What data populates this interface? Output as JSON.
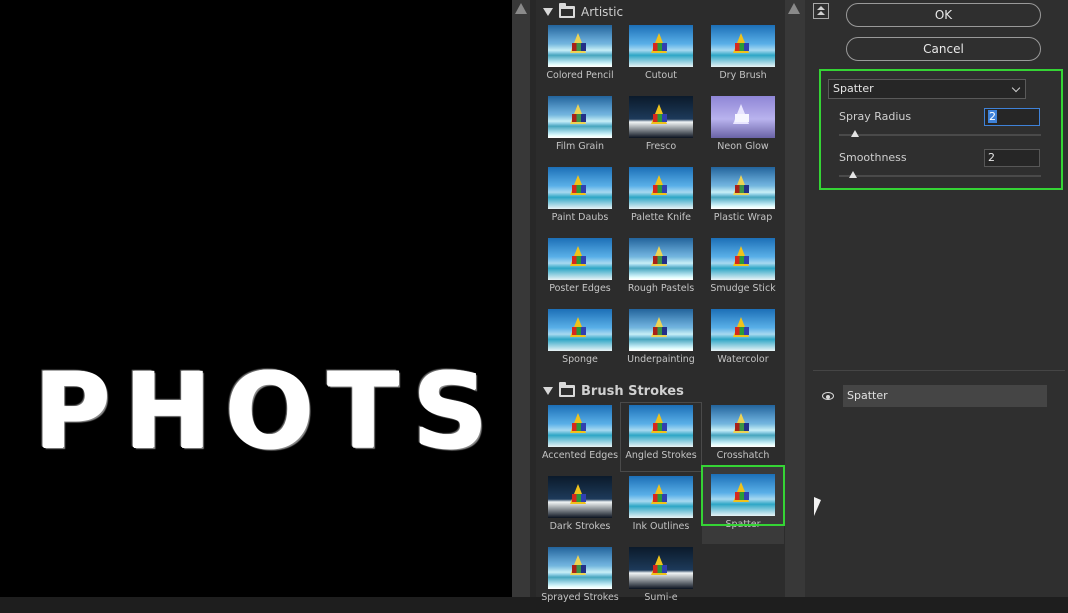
{
  "preview": {
    "text": "PHOTS"
  },
  "gallery": {
    "categories": [
      {
        "name": "Artistic",
        "filters": [
          "Colored Pencil",
          "Cutout",
          "Dry Brush",
          "Film Grain",
          "Fresco",
          "Neon Glow",
          "Paint Daubs",
          "Palette Knife",
          "Plastic Wrap",
          "Poster Edges",
          "Rough Pastels",
          "Smudge Stick",
          "Sponge",
          "Underpainting",
          "Watercolor"
        ]
      },
      {
        "name": "Brush Strokes",
        "filters": [
          "Accented Edges",
          "Angled Strokes",
          "Crosshatch",
          "Dark Strokes",
          "Ink Outlines",
          "Spatter",
          "Sprayed Strokes",
          "Sumi-e"
        ]
      }
    ],
    "selected_filter": "Spatter"
  },
  "dialog": {
    "ok_label": "OK",
    "cancel_label": "Cancel"
  },
  "settings": {
    "filter_select": "Spatter",
    "params": [
      {
        "label": "Spray Radius",
        "value": "2"
      },
      {
        "label": "Smoothness",
        "value": "2"
      }
    ]
  },
  "layers": {
    "items": [
      {
        "name": "Spatter",
        "visible": true
      }
    ]
  },
  "colors": {
    "highlight": "#35d435",
    "focus": "#3f82d8"
  }
}
